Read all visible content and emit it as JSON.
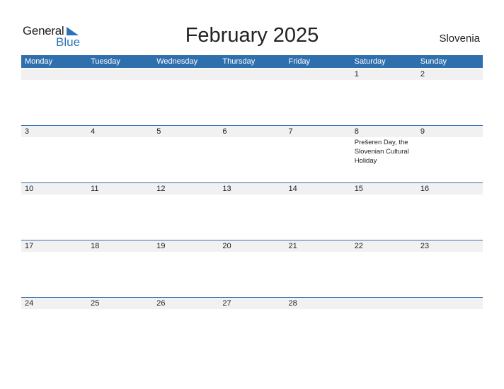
{
  "logo": {
    "general": "General",
    "blue": "Blue",
    "accent": "#2a73b8"
  },
  "title": "February 2025",
  "country": "Slovenia",
  "colors": {
    "header_bg": "#2f6fae",
    "date_strip_bg": "#f1f1f1"
  },
  "weekdays": [
    "Monday",
    "Tuesday",
    "Wednesday",
    "Thursday",
    "Friday",
    "Saturday",
    "Sunday"
  ],
  "weeks": [
    [
      {
        "day": ""
      },
      {
        "day": ""
      },
      {
        "day": ""
      },
      {
        "day": ""
      },
      {
        "day": ""
      },
      {
        "day": "1"
      },
      {
        "day": "2"
      }
    ],
    [
      {
        "day": "3"
      },
      {
        "day": "4"
      },
      {
        "day": "5"
      },
      {
        "day": "6"
      },
      {
        "day": "7"
      },
      {
        "day": "8",
        "event": "Prešeren Day, the Slovenian Cultural Holiday"
      },
      {
        "day": "9"
      }
    ],
    [
      {
        "day": "10"
      },
      {
        "day": "11"
      },
      {
        "day": "12"
      },
      {
        "day": "13"
      },
      {
        "day": "14"
      },
      {
        "day": "15"
      },
      {
        "day": "16"
      }
    ],
    [
      {
        "day": "17"
      },
      {
        "day": "18"
      },
      {
        "day": "19"
      },
      {
        "day": "20"
      },
      {
        "day": "21"
      },
      {
        "day": "22"
      },
      {
        "day": "23"
      }
    ],
    [
      {
        "day": "24"
      },
      {
        "day": "25"
      },
      {
        "day": "26"
      },
      {
        "day": "27"
      },
      {
        "day": "28"
      },
      {
        "day": ""
      },
      {
        "day": ""
      }
    ]
  ]
}
